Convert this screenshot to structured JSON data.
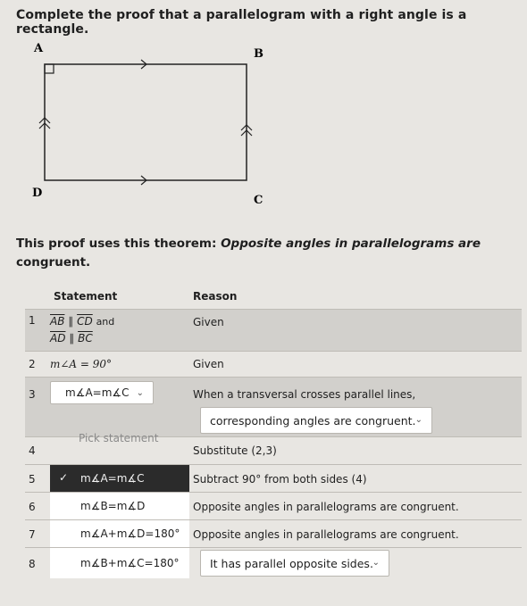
{
  "question": "Complete the proof that a parallelogram with a right angle is a rectangle.",
  "figure": {
    "vertex_a": "A",
    "vertex_b": "B",
    "vertex_c": "C",
    "vertex_d": "D"
  },
  "theorem": {
    "prefix": "This proof uses this theorem: ",
    "name": "Opposite angles in parallelograms are",
    "name_cont": "congruent."
  },
  "table": {
    "header_statement": "Statement",
    "header_reason": "Reason",
    "rows": [
      {
        "num": "1",
        "stmt_a1": "AB",
        "stmt_par": "∥",
        "stmt_a2": "CD",
        "stmt_and": "and",
        "stmt_b1": "AD",
        "stmt_b2": "BC",
        "reason": "Given"
      },
      {
        "num": "2",
        "stmt": "m∠A = 90°",
        "reason": "Given"
      },
      {
        "num": "3",
        "stmt": "m∡A=m∡C",
        "reason_line1": "When a transversal crosses parallel lines,",
        "reason_line2": "corresponding angles are congruent."
      },
      {
        "num": "4",
        "stmt_placeholder": "Pick statement",
        "reason": "Substitute (2,3)"
      },
      {
        "num": "5",
        "stmt": "m∡A=m∡C",
        "reason": "Subtract 90° from both sides (4)"
      },
      {
        "num": "6",
        "stmt": "m∡B=m∡D",
        "reason": "Opposite angles in parallelograms are congruent."
      },
      {
        "num": "7",
        "stmt": "m∡A+m∡D=180°",
        "reason": "Opposite angles in parallelograms are congruent."
      },
      {
        "num": "8",
        "stmt": "m∡B+m∡C=180°",
        "reason": "It has parallel opposite sides."
      }
    ]
  },
  "icons": {
    "dropdown": "chevron-down-icon",
    "check": "check-icon"
  }
}
